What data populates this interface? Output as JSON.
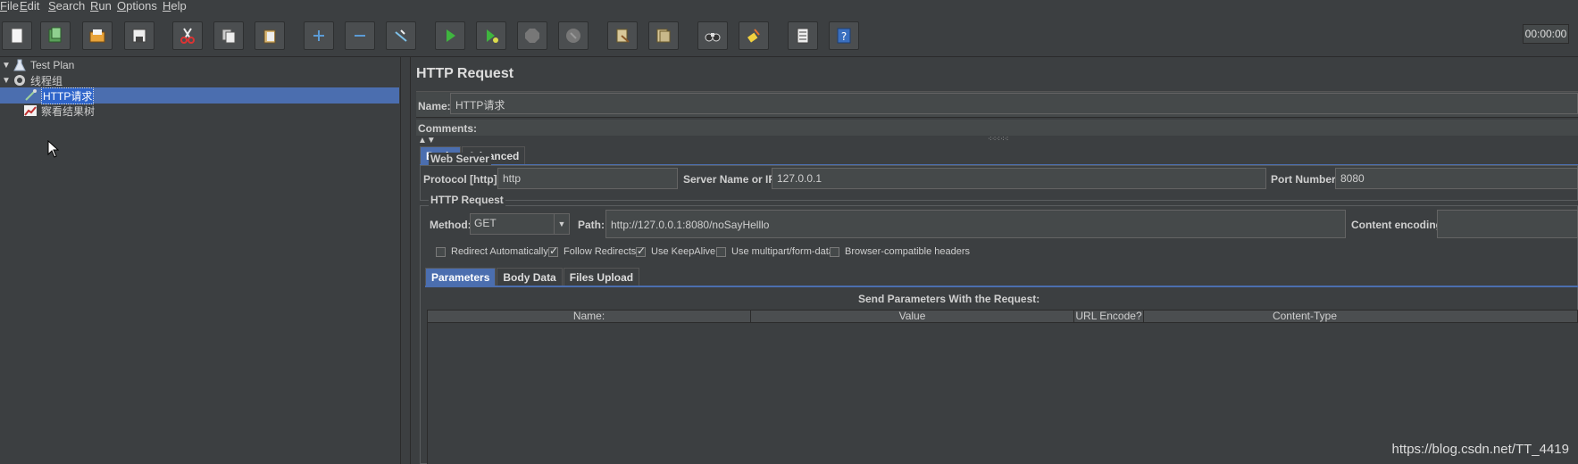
{
  "menu": {
    "items": [
      {
        "label": "ile",
        "u": "F"
      },
      {
        "label": "dit",
        "u": "E"
      },
      {
        "label": "earch",
        "u": "S"
      },
      {
        "label": "un",
        "u": "R"
      },
      {
        "label": "ptions",
        "u": "O"
      },
      {
        "label": "elp",
        "u": "H"
      }
    ]
  },
  "toolbar": {
    "buttons": [
      "new-icon",
      "templates-icon",
      "open-icon",
      "save-icon",
      "cut-icon",
      "copy-icon",
      "paste-icon",
      "expand-icon",
      "collapse-icon",
      "toggle-icon",
      "start-icon",
      "start-no-pause-icon",
      "stop-icon",
      "shutdown-icon",
      "clear-icon",
      "clear-all-icon",
      "search-icon",
      "reset-search-icon",
      "function-helper-icon",
      "help-icon"
    ],
    "timer": "00:00:00"
  },
  "tree": {
    "items": [
      {
        "label": "Test Plan"
      },
      {
        "label": "线程组"
      },
      {
        "label": "HTTP请求"
      },
      {
        "label": "察看结果树"
      }
    ]
  },
  "panel": {
    "title": "HTTP Request",
    "name_label": "Name:",
    "name_value": "HTTP请求",
    "comments_label": "Comments:",
    "tabs": [
      "Basic",
      "Advanced"
    ],
    "web_server": {
      "title": "Web Server",
      "protocol_label": "Protocol [http]:",
      "protocol_value": "http",
      "server_label": "Server Name or IP:",
      "server_value": "127.0.0.1",
      "port_label": "Port Number:",
      "port_value": "8080"
    },
    "http_request": {
      "title": "HTTP Request",
      "method_label": "Method:",
      "method_value": "GET",
      "path_label": "Path:",
      "path_value": "http://127.0.0.1:8080/noSayHelllo",
      "encoding_label": "Content encoding:"
    },
    "checkboxes": [
      {
        "label": "Redirect Automatically",
        "checked": false
      },
      {
        "label": "Follow Redirects",
        "checked": true
      },
      {
        "label": "Use KeepAlive",
        "checked": true
      },
      {
        "label": "Use multipart/form-data",
        "checked": false
      },
      {
        "label": "Browser-compatible headers",
        "checked": false
      }
    ],
    "param_tabs": [
      "Parameters",
      "Body Data",
      "Files Upload"
    ],
    "params_title": "Send Parameters With the Request:",
    "columns": [
      "Name:",
      "Value",
      "URL Encode?",
      "Content-Type"
    ]
  },
  "watermark": "https://blog.csdn.net/TT_4419"
}
